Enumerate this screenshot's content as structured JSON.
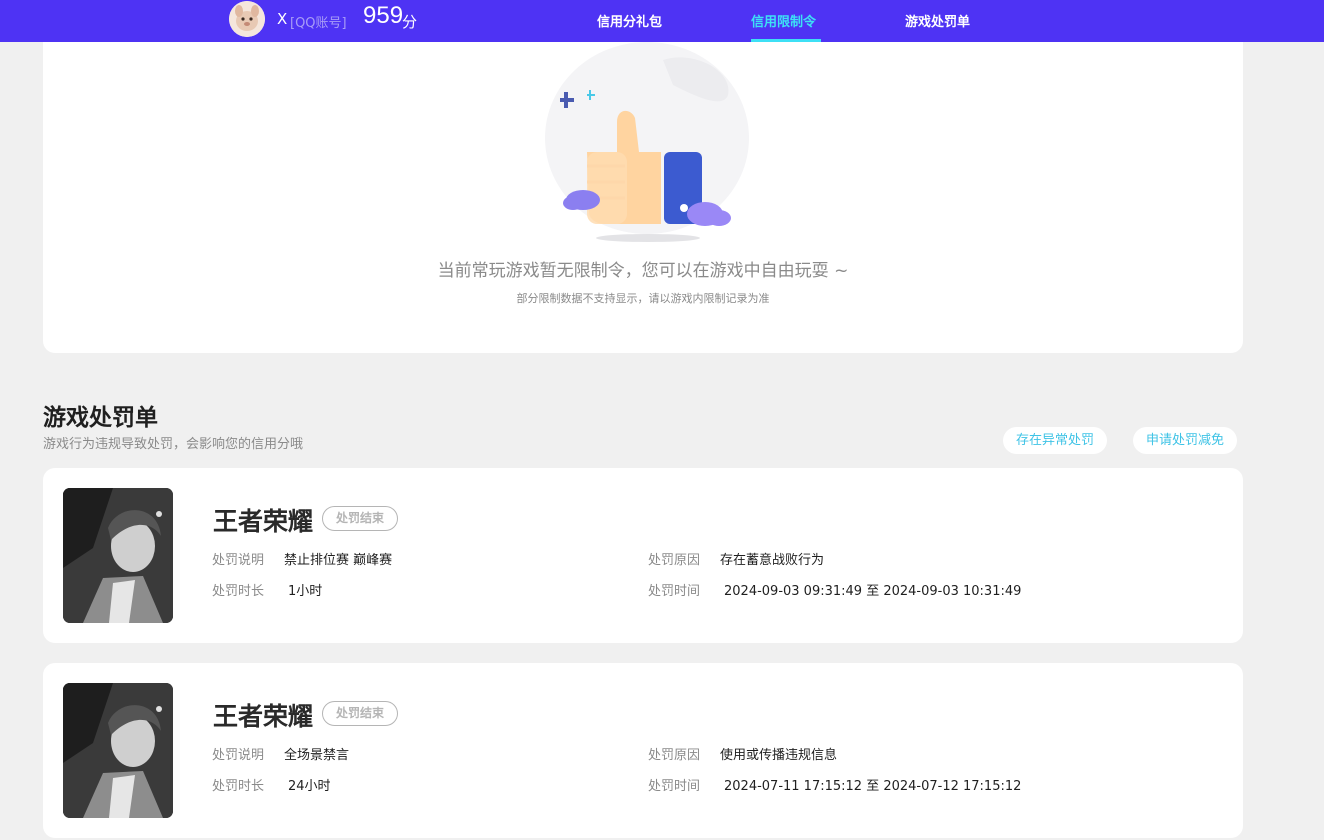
{
  "header": {
    "user_name": "X",
    "account_type": "[QQ账号]",
    "score": "959",
    "score_unit": "分",
    "tabs": [
      {
        "label": "信用分礼包",
        "active": false
      },
      {
        "label": "信用限制令",
        "active": true
      },
      {
        "label": "游戏处罚单",
        "active": false
      }
    ]
  },
  "restriction": {
    "empty_title": "当前常玩游戏暂无限制令，您可以在游戏中自由玩耍 ~",
    "empty_subtitle": "部分限制数据不支持显示，请以游戏内限制记录为准"
  },
  "punishments": {
    "title": "游戏处罚单",
    "subtitle": "游戏行为违规导致处罚，会影响您的信用分哦",
    "actions": [
      "存在异常处罚",
      "申请处罚减免"
    ],
    "labels": {
      "desc": "处罚说明",
      "duration": "处罚时长",
      "reason": "处罚原因",
      "time": "处罚时间"
    },
    "items": [
      {
        "game": "王者荣耀",
        "status": "处罚结束",
        "desc": "禁止排位赛 巅峰赛",
        "duration": "1小时",
        "reason": "存在蓄意战败行为",
        "time": "2024-09-03 09:31:49 至 2024-09-03 10:31:49"
      },
      {
        "game": "王者荣耀",
        "status": "处罚结束",
        "desc": "全场景禁言",
        "duration": "24小时",
        "reason": "使用或传播违规信息",
        "time": "2024-07-11 17:15:12 至 2024-07-12 17:15:12"
      }
    ]
  },
  "colors": {
    "brand": "#4e33f4",
    "active_tab": "#3de0f5",
    "action_text": "#3fc3e6"
  }
}
